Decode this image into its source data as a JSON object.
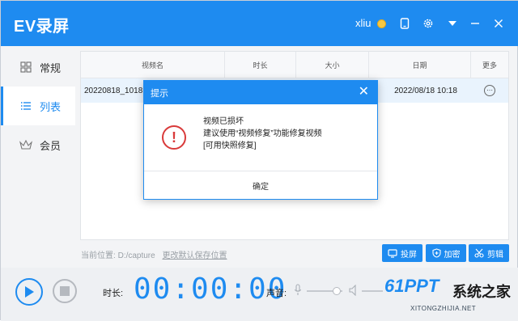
{
  "app": {
    "title": "EV录屏",
    "username": "xliu",
    "colors": {
      "primary": "#1e8bf0",
      "danger": "#d93a3a"
    }
  },
  "titlebar_icons": [
    "coin-icon",
    "phone-icon",
    "settings-icon",
    "menu-icon",
    "minimize-icon",
    "close-icon"
  ],
  "sidebar": {
    "items": [
      {
        "label": "常规",
        "icon": "grid-icon"
      },
      {
        "label": "列表",
        "icon": "list-icon",
        "active": true
      },
      {
        "label": "会员",
        "icon": "crown-icon"
      }
    ]
  },
  "table": {
    "headers": [
      "视频名",
      "时长",
      "大小",
      "日期",
      "更多"
    ],
    "rows": [
      {
        "name": "20220818_101810",
        "duration": "",
        "size": "",
        "date": "2022/08/18 10:18",
        "more": "⋯"
      }
    ]
  },
  "location": {
    "label": "当前位置:",
    "path": "D:/capture",
    "change_link": "更改默认保存位置"
  },
  "actions": {
    "cast": "投屏",
    "encrypt": "加密",
    "edit": "剪辑"
  },
  "controls": {
    "duration_label": "时长:",
    "timer": "00:00:00",
    "volume_label": "声音:"
  },
  "watermark": {
    "brand": "61PPT",
    "site": "XITONGZHIJIA.NET",
    "cn": "系统之家"
  },
  "dialog": {
    "title": "提示",
    "close": "✕",
    "line1": "视频已损坏",
    "line2": "建议使用“视频修复”功能修复视频",
    "line3": "[可用快照修复]",
    "ok": "确定"
  }
}
